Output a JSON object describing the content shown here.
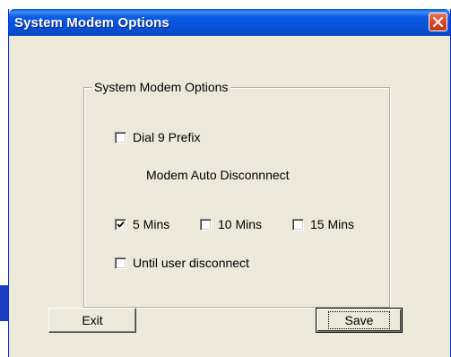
{
  "window": {
    "title": "System Modem Options",
    "close_icon": "close-icon"
  },
  "group": {
    "legend": "System Modem Options",
    "dial_prefix": {
      "label": "Dial 9 Prefix",
      "checked": false
    },
    "auto_disconnect_heading": "Modem Auto Disconnnect",
    "intervals": [
      {
        "label": "5 Mins",
        "checked": true
      },
      {
        "label": "10 Mins",
        "checked": false
      },
      {
        "label": "15 Mins",
        "checked": false
      }
    ],
    "until_user": {
      "label": "Until user disconnect",
      "checked": false
    }
  },
  "buttons": {
    "exit_label": "Exit",
    "save_label": "Save"
  },
  "colors": {
    "titlebar": "#0751d8",
    "face": "#ece9d8",
    "close": "#d9452a"
  }
}
